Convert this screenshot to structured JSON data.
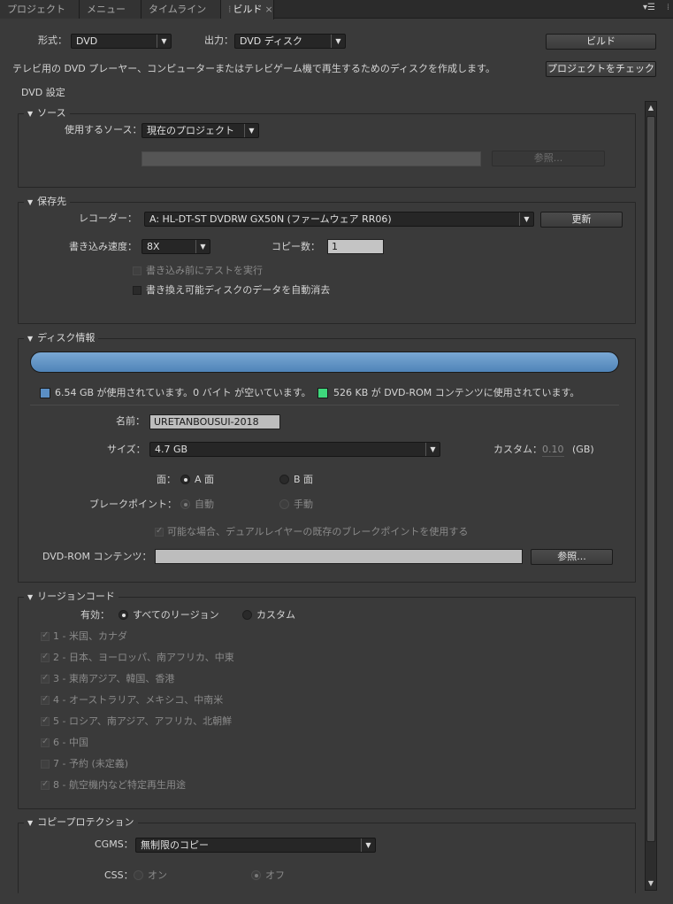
{
  "tabs": [
    {
      "label": "プロジェクト"
    },
    {
      "label": "メニュー"
    },
    {
      "label": "タイムライン"
    },
    {
      "label": "ビルド"
    }
  ],
  "top": {
    "format_label": "形式：",
    "format_value": "DVD",
    "output_label": "出力：",
    "output_value": "DVD ディスク",
    "build_button": "ビルド",
    "check_button": "プロジェクトをチェック",
    "description": "テレビ用の DVD プレーヤー、コンピューターまたはテレビゲーム機で再生するためのディスクを作成します。",
    "settings_heading": "DVD 設定"
  },
  "source": {
    "title": "ソース",
    "use_label": "使用するソース：",
    "use_value": "現在のプロジェクト",
    "browse_button": "参照..."
  },
  "destination": {
    "title": "保存先",
    "recorder_label": "レコーダー：",
    "recorder_value": "A: HL-DT-ST DVDRW  GX50N (ファームウェア RR06)",
    "update_button": "更新",
    "speed_label": "書き込み速度：",
    "speed_value": "8X",
    "copies_label": "コピー数：",
    "copies_value": "1",
    "test_label": "書き込み前にテストを実行",
    "erase_label": "書き換え可能ディスクのデータを自動消去"
  },
  "disc": {
    "title": "ディスク情報",
    "used_text": "6.54 GB が使用されています。0 バイト が空いています。",
    "rom_text": "526 KB が DVD-ROM コンテンツに使用されています。",
    "name_label": "名前：",
    "name_value": "URETANBOUSUI-2018",
    "size_label": "サイズ：",
    "size_value": "4.7 GB",
    "custom_label": "カスタム：",
    "custom_value": "0.10",
    "custom_unit": "(GB)",
    "side_label": "面：",
    "side_a": "A 面",
    "side_b": "B 面",
    "breakpoint_label": "ブレークポイント：",
    "bp_auto": "自動",
    "bp_manual": "手動",
    "dual_layer_label": "可能な場合、デュアルレイヤーの既存のブレークポイントを使用する",
    "rom_label": "DVD-ROM コンテンツ：",
    "rom_browse": "参照...",
    "used_color": "#5b8fc4",
    "rom_color": "#3ed87c"
  },
  "region": {
    "title": "リージョンコード",
    "enabled_label": "有効：",
    "all_label": "すべてのリージョン",
    "custom_label": "カスタム",
    "items": [
      {
        "label": "1 - 米国、カナダ",
        "checked": true
      },
      {
        "label": "2 - 日本、ヨーロッパ、南アフリカ、中東",
        "checked": true
      },
      {
        "label": "3 - 東南アジア、韓国、香港",
        "checked": true
      },
      {
        "label": "4 - オーストラリア、メキシコ、中南米",
        "checked": true
      },
      {
        "label": "5 - ロシア、南アジア、アフリカ、北朝鮮",
        "checked": true
      },
      {
        "label": "6 - 中国",
        "checked": true
      },
      {
        "label": "7 - 予約 (未定義)",
        "checked": false
      },
      {
        "label": "8 - 航空機内など特定再生用途",
        "checked": true
      }
    ]
  },
  "protection": {
    "title": "コピープロテクション",
    "cgms_label": "CGMS：",
    "cgms_value": "無制限のコピー",
    "css_label": "CSS：",
    "css_on": "オン",
    "css_off": "オフ"
  }
}
